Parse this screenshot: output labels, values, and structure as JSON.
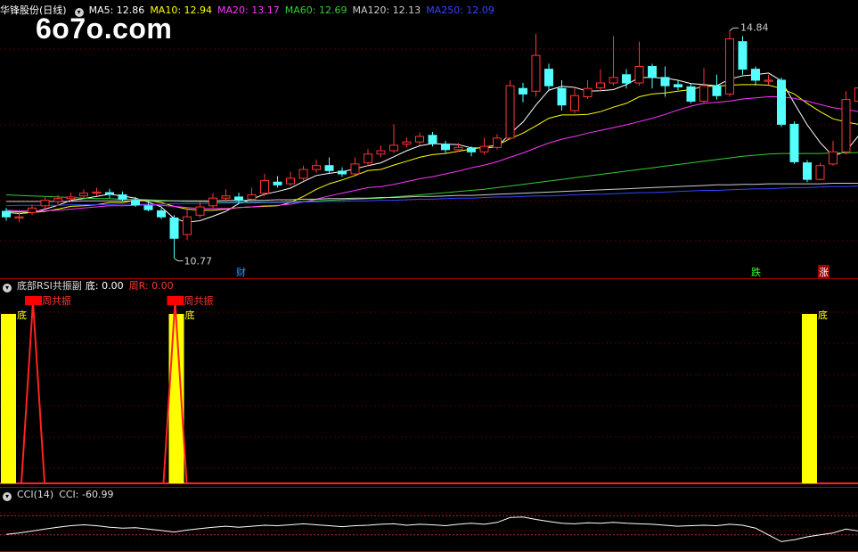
{
  "price_panel": {
    "stock_name": "华锋股份(日线)",
    "ma": [
      {
        "label": "MA5: 12.86",
        "color": "#ffffff"
      },
      {
        "label": "MA10: 12.94",
        "color": "#ffff00"
      },
      {
        "label": "MA20: 13.17",
        "color": "#ff33ff"
      },
      {
        "label": "MA60: 12.69",
        "color": "#33cc33"
      },
      {
        "label": "MA120: 12.13",
        "color": "#cccccc"
      },
      {
        "label": "MA250: 12.09",
        "color": "#3344ff"
      }
    ],
    "high_label": "14.84",
    "low_label": "10.77",
    "markers": {
      "cai": "财",
      "die": "跌",
      "zhang": "涨"
    }
  },
  "watermark": "6o7o.com",
  "rsi_panel": {
    "title": "底部RSI共振副",
    "di_label": "底: 0.00",
    "zhou_label": "周R: 0.00",
    "di_text": "底",
    "zhou_gongzhen_text": "周共振"
  },
  "cci_panel": {
    "title": "CCI(14)",
    "value_label": "CCI: -60.99"
  },
  "chart_data": {
    "type": "candlestick",
    "candles": [
      [
        11.62,
        11.52,
        11.68,
        11.45
      ],
      [
        11.5,
        11.52,
        11.6,
        11.42
      ],
      [
        11.6,
        11.68,
        11.74,
        11.55
      ],
      [
        11.72,
        11.82,
        11.88,
        11.66
      ],
      [
        11.8,
        11.85,
        11.92,
        11.75
      ],
      [
        11.85,
        11.88,
        11.96,
        11.8
      ],
      [
        11.9,
        11.95,
        12.02,
        11.86
      ],
      [
        11.95,
        11.97,
        12.05,
        11.9
      ],
      [
        11.96,
        11.93,
        12.03,
        11.86
      ],
      [
        11.92,
        11.84,
        11.98,
        11.8
      ],
      [
        11.82,
        11.74,
        11.88,
        11.7
      ],
      [
        11.72,
        11.65,
        11.78,
        11.62
      ],
      [
        11.63,
        11.52,
        11.68,
        11.48
      ],
      [
        11.5,
        11.13,
        11.55,
        10.77
      ],
      [
        11.2,
        11.52,
        11.7,
        11.1
      ],
      [
        11.55,
        11.7,
        11.8,
        11.5
      ],
      [
        11.72,
        11.86,
        11.95,
        11.66
      ],
      [
        11.86,
        11.9,
        12.02,
        11.8
      ],
      [
        11.88,
        11.82,
        11.96,
        11.76
      ],
      [
        11.84,
        11.92,
        12.05,
        11.8
      ],
      [
        11.95,
        12.18,
        12.3,
        11.9
      ],
      [
        12.15,
        12.1,
        12.26,
        12.05
      ],
      [
        12.12,
        12.22,
        12.34,
        12.08
      ],
      [
        12.22,
        12.38,
        12.45,
        12.18
      ],
      [
        12.38,
        12.45,
        12.56,
        12.32
      ],
      [
        12.45,
        12.36,
        12.6,
        12.3
      ],
      [
        12.35,
        12.3,
        12.42,
        12.25
      ],
      [
        12.3,
        12.48,
        12.6,
        12.28
      ],
      [
        12.5,
        12.66,
        12.75,
        12.44
      ],
      [
        12.66,
        12.72,
        12.82,
        12.6
      ],
      [
        12.72,
        12.82,
        13.2,
        12.68
      ],
      [
        12.84,
        12.88,
        12.96,
        12.78
      ],
      [
        12.88,
        12.98,
        13.05,
        12.82
      ],
      [
        13.0,
        12.86,
        13.06,
        12.8
      ],
      [
        12.84,
        12.74,
        12.9,
        12.68
      ],
      [
        12.74,
        12.78,
        12.86,
        12.7
      ],
      [
        12.76,
        12.7,
        12.8,
        12.62
      ],
      [
        12.7,
        12.8,
        12.96,
        12.65
      ],
      [
        12.78,
        12.95,
        13.02,
        12.74
      ],
      [
        12.95,
        13.9,
        14.0,
        12.92
      ],
      [
        13.85,
        13.75,
        13.95,
        13.6
      ],
      [
        13.8,
        14.45,
        14.84,
        13.7
      ],
      [
        14.2,
        13.9,
        14.3,
        13.8
      ],
      [
        13.85,
        13.55,
        14.0,
        13.45
      ],
      [
        13.45,
        13.72,
        13.85,
        13.4
      ],
      [
        13.7,
        13.85,
        14.0,
        13.66
      ],
      [
        13.86,
        13.95,
        14.2,
        13.8
      ],
      [
        13.95,
        14.05,
        14.8,
        13.9
      ],
      [
        14.1,
        13.95,
        14.2,
        13.85
      ],
      [
        13.95,
        14.25,
        14.7,
        13.9
      ],
      [
        14.25,
        14.05,
        14.3,
        13.85
      ],
      [
        14.05,
        13.9,
        14.25,
        13.7
      ],
      [
        13.92,
        13.88,
        14.0,
        13.82
      ],
      [
        13.88,
        13.62,
        13.95,
        13.58
      ],
      [
        13.62,
        13.9,
        14.22,
        13.58
      ],
      [
        13.9,
        13.72,
        14.1,
        13.65
      ],
      [
        13.75,
        14.75,
        14.9,
        13.7
      ],
      [
        14.7,
        14.2,
        14.8,
        14.1
      ],
      [
        14.2,
        14.0,
        14.25,
        13.9
      ],
      [
        13.98,
        14.0,
        14.1,
        13.92
      ],
      [
        14.0,
        13.2,
        14.05,
        13.15
      ],
      [
        13.2,
        12.52,
        13.25,
        12.48
      ],
      [
        12.5,
        12.2,
        12.55,
        12.15
      ],
      [
        12.2,
        12.45,
        12.5,
        12.18
      ],
      [
        12.48,
        12.7,
        12.9,
        12.45
      ],
      [
        12.7,
        13.65,
        13.8,
        12.65
      ],
      [
        13.62,
        13.86,
        14.0,
        13.55
      ],
      [
        13.86,
        13.66,
        14.0,
        13.58
      ],
      [
        13.66,
        13.84,
        14.05,
        13.6
      ]
    ],
    "ma_series": [
      {
        "label": "MA5",
        "color": "#ffffff",
        "values": [
          11.6,
          11.58,
          11.6,
          11.66,
          11.73,
          11.82,
          11.85,
          11.89,
          11.93,
          11.9,
          11.86,
          11.79,
          11.7,
          11.49,
          11.42,
          11.45,
          11.53,
          11.62,
          11.76,
          11.84,
          11.93,
          11.98,
          12.04,
          12.16,
          12.27,
          12.31,
          12.34,
          12.39,
          12.45,
          12.5,
          12.61,
          12.72,
          12.81,
          12.85,
          12.84,
          12.83,
          12.77,
          12.77,
          12.79,
          13.03,
          13.24,
          13.55,
          13.82,
          13.89,
          13.87,
          13.8,
          13.81,
          13.83,
          13.92,
          14.05,
          14.05,
          14.04,
          14.0,
          13.94,
          13.92,
          13.9,
          14.02,
          14.08,
          14.1,
          14.13,
          13.99,
          13.58,
          13.19,
          12.87,
          12.62,
          12.71,
          13.0,
          13.28,
          13.56
        ]
      },
      {
        "label": "MA10",
        "color": "#ffff00",
        "values": [
          11.62,
          11.61,
          11.6,
          11.62,
          11.66,
          11.71,
          11.72,
          11.74,
          11.78,
          11.78,
          11.82,
          11.82,
          11.78,
          11.71,
          11.66,
          11.64,
          11.64,
          11.66,
          11.69,
          11.7,
          11.71,
          11.72,
          11.78,
          11.89,
          12.02,
          12.12,
          12.19,
          12.27,
          12.36,
          12.38,
          12.46,
          12.53,
          12.6,
          12.65,
          12.67,
          12.71,
          12.75,
          12.79,
          12.82,
          12.94,
          13.04,
          13.17,
          13.31,
          13.37,
          13.37,
          13.38,
          13.43,
          13.51,
          13.58,
          13.7,
          13.75,
          13.77,
          13.8,
          13.83,
          13.89,
          13.89,
          13.91,
          13.92,
          13.92,
          13.91,
          13.85,
          13.75,
          13.58,
          13.43,
          13.3,
          13.24,
          13.2,
          13.17,
          13.16
        ]
      },
      {
        "label": "MA20",
        "color": "#ff33ff",
        "values": [
          11.64,
          11.63,
          11.63,
          11.63,
          11.64,
          11.66,
          11.68,
          11.7,
          11.72,
          11.72,
          11.73,
          11.74,
          11.73,
          11.71,
          11.69,
          11.67,
          11.67,
          11.67,
          11.69,
          11.7,
          11.72,
          11.73,
          11.75,
          11.79,
          11.84,
          11.9,
          11.95,
          12.0,
          12.05,
          12.07,
          12.11,
          12.16,
          12.21,
          12.25,
          12.3,
          12.35,
          12.41,
          12.46,
          12.52,
          12.6,
          12.68,
          12.77,
          12.86,
          12.93,
          12.98,
          13.04,
          13.09,
          13.14,
          13.19,
          13.25,
          13.31,
          13.38,
          13.46,
          13.53,
          13.58,
          13.6,
          13.62,
          13.66,
          13.68,
          13.7,
          13.7,
          13.67,
          13.62,
          13.56,
          13.5,
          13.47,
          13.43,
          13.4,
          13.38
        ]
      },
      {
        "label": "MA60",
        "color": "#33cc33",
        "values": [
          11.92,
          11.91,
          11.9,
          11.89,
          11.88,
          11.87,
          11.86,
          11.85,
          11.85,
          11.84,
          11.84,
          11.83,
          11.82,
          11.81,
          11.8,
          11.8,
          11.79,
          11.79,
          11.79,
          11.79,
          11.79,
          11.79,
          11.8,
          11.8,
          11.81,
          11.82,
          11.83,
          11.84,
          11.85,
          11.86,
          11.88,
          11.9,
          11.92,
          11.94,
          11.96,
          11.98,
          12.0,
          12.02,
          12.05,
          12.08,
          12.11,
          12.14,
          12.17,
          12.2,
          12.23,
          12.26,
          12.29,
          12.32,
          12.35,
          12.38,
          12.41,
          12.44,
          12.47,
          12.5,
          12.53,
          12.56,
          12.59,
          12.62,
          12.64,
          12.66,
          12.67,
          12.67,
          12.67,
          12.67,
          12.68,
          12.68,
          12.69,
          12.69,
          12.69
        ]
      },
      {
        "label": "MA120",
        "color": "#cccccc",
        "values": [
          11.8,
          11.8,
          11.8,
          11.8,
          11.8,
          11.8,
          11.81,
          11.81,
          11.81,
          11.81,
          11.81,
          11.81,
          11.81,
          11.81,
          11.81,
          11.81,
          11.81,
          11.82,
          11.82,
          11.82,
          11.82,
          11.83,
          11.83,
          11.84,
          11.84,
          11.85,
          11.85,
          11.86,
          11.86,
          11.87,
          11.87,
          11.88,
          11.89,
          11.89,
          11.9,
          11.91,
          11.91,
          11.92,
          11.93,
          11.94,
          11.95,
          11.96,
          11.97,
          11.98,
          11.99,
          12.0,
          12.01,
          12.02,
          12.03,
          12.04,
          12.05,
          12.06,
          12.07,
          12.08,
          12.09,
          12.1,
          12.1,
          12.11,
          12.11,
          12.12,
          12.12,
          12.12,
          12.12,
          12.12,
          12.13,
          12.13,
          12.13,
          12.13,
          12.13
        ]
      },
      {
        "label": "MA250",
        "color": "#3344ff",
        "values": [
          11.72,
          11.73,
          11.73,
          11.73,
          11.73,
          11.74,
          11.74,
          11.74,
          11.74,
          11.75,
          11.75,
          11.75,
          11.75,
          11.76,
          11.76,
          11.76,
          11.76,
          11.77,
          11.77,
          11.77,
          11.78,
          11.78,
          11.78,
          11.79,
          11.79,
          11.8,
          11.8,
          11.81,
          11.81,
          11.82,
          11.82,
          11.83,
          11.84,
          11.84,
          11.85,
          11.86,
          11.86,
          11.87,
          11.88,
          11.88,
          11.89,
          11.9,
          11.9,
          11.91,
          11.92,
          11.93,
          11.93,
          11.94,
          11.95,
          11.96,
          11.96,
          11.97,
          11.98,
          11.99,
          12.0,
          12.0,
          12.01,
          12.02,
          12.03,
          12.03,
          12.04,
          12.05,
          12.05,
          12.06,
          12.07,
          12.07,
          12.08,
          12.08,
          12.09
        ]
      }
    ],
    "rsi_yellow_bars": [
      0,
      13,
      62
    ],
    "rsi_red_spikes": [
      2,
      13
    ],
    "cci_values": [
      -95,
      -80,
      -60,
      -40,
      -20,
      -5,
      5,
      -5,
      -20,
      -30,
      -25,
      -40,
      -55,
      -70,
      -50,
      -35,
      -20,
      -10,
      -20,
      -10,
      0,
      -5,
      5,
      15,
      5,
      -5,
      -15,
      -5,
      0,
      10,
      15,
      0,
      10,
      5,
      -5,
      10,
      20,
      10,
      30,
      80,
      85,
      60,
      40,
      20,
      15,
      25,
      20,
      30,
      20,
      15,
      10,
      0,
      -10,
      -5,
      0,
      -5,
      10,
      0,
      -30,
      -100,
      -170,
      -150,
      -120,
      -100,
      -80,
      -40,
      -60,
      -50,
      -60
    ],
    "cci_range": [
      -250,
      250
    ]
  }
}
